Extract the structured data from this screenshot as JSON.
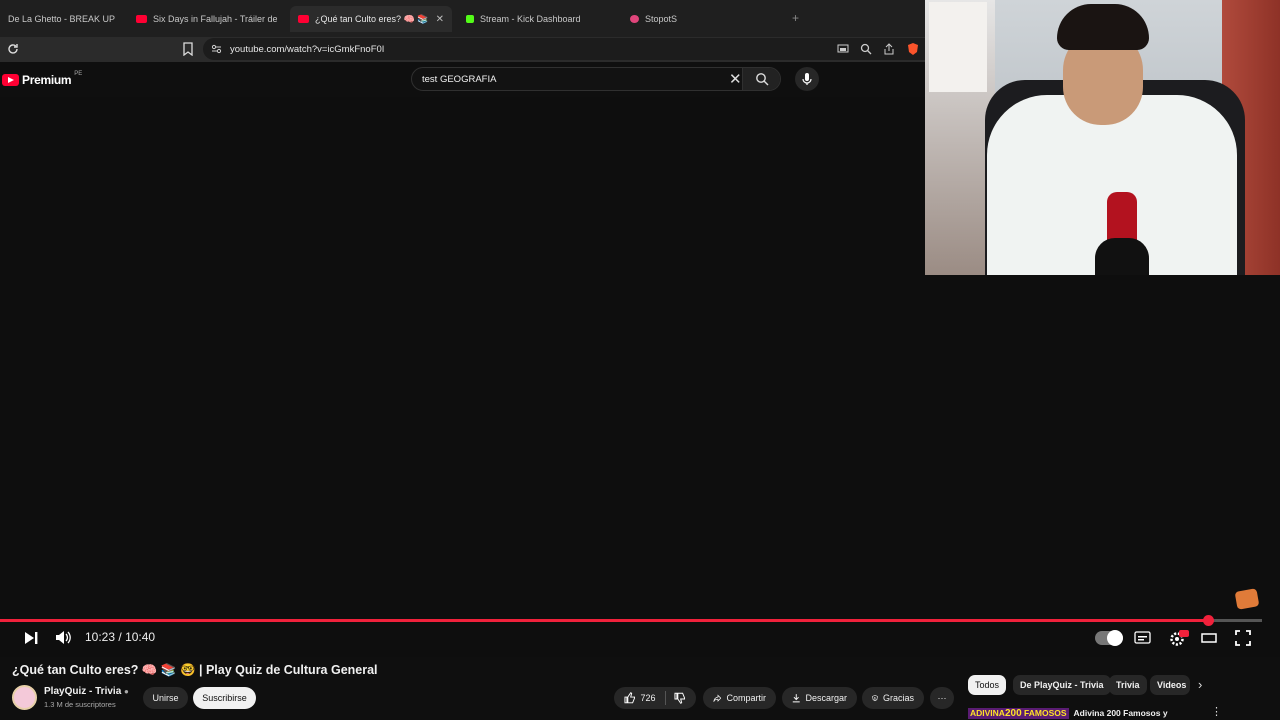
{
  "browser": {
    "tabs": [
      {
        "label": "De La Ghetto - BREAK UP (Aud",
        "fav_color": "#1f1f1f"
      },
      {
        "label": "Six Days in Fallujah - Tráiler de Ga",
        "fav_color": "#ff0033"
      },
      {
        "label": "¿Qué tan Culto eres? 🧠 📚 🤓",
        "fav_color": "#ff0033",
        "active": true
      },
      {
        "label": "Stream - Kick Dashboard",
        "fav_color": "#53fc18"
      },
      {
        "label": "StopotS",
        "fav_color": "#e0457b"
      }
    ],
    "new_tab": "+",
    "url": "youtube.com/watch?v=icGmkFnoF0I"
  },
  "youtube": {
    "logo_text": "Premium",
    "country_code": "PE",
    "search_value": "test  GEOGRAFIA"
  },
  "player": {
    "time_current": "10:23",
    "time_separator": "/",
    "time_total": "10:40",
    "progress_fraction": 0.9576,
    "accent_color": "#f0213b"
  },
  "video": {
    "title": "¿Qué tan Culto eres? 🧠 📚 🤓 | Play Quiz de Cultura General",
    "channel_name": "PlayQuiz - Trivia",
    "subscribers": "1.3 M de suscriptores",
    "join_label": "Unirse",
    "subscribe_label": "Suscribirse",
    "likes": "726",
    "share_label": "Compartir",
    "download_label": "Descargar",
    "thanks_label": "Gracias",
    "more_label": "···"
  },
  "sidebar": {
    "chips": [
      "Todos",
      "De PlayQuiz - Trivia",
      "Trivia",
      "Videos"
    ],
    "recommendation": {
      "thumb_text_a": "ADIVINA",
      "thumb_text_b": "200",
      "thumb_text_c": "FAMOSOS",
      "title": "Adivina 200 Famosos y"
    }
  }
}
